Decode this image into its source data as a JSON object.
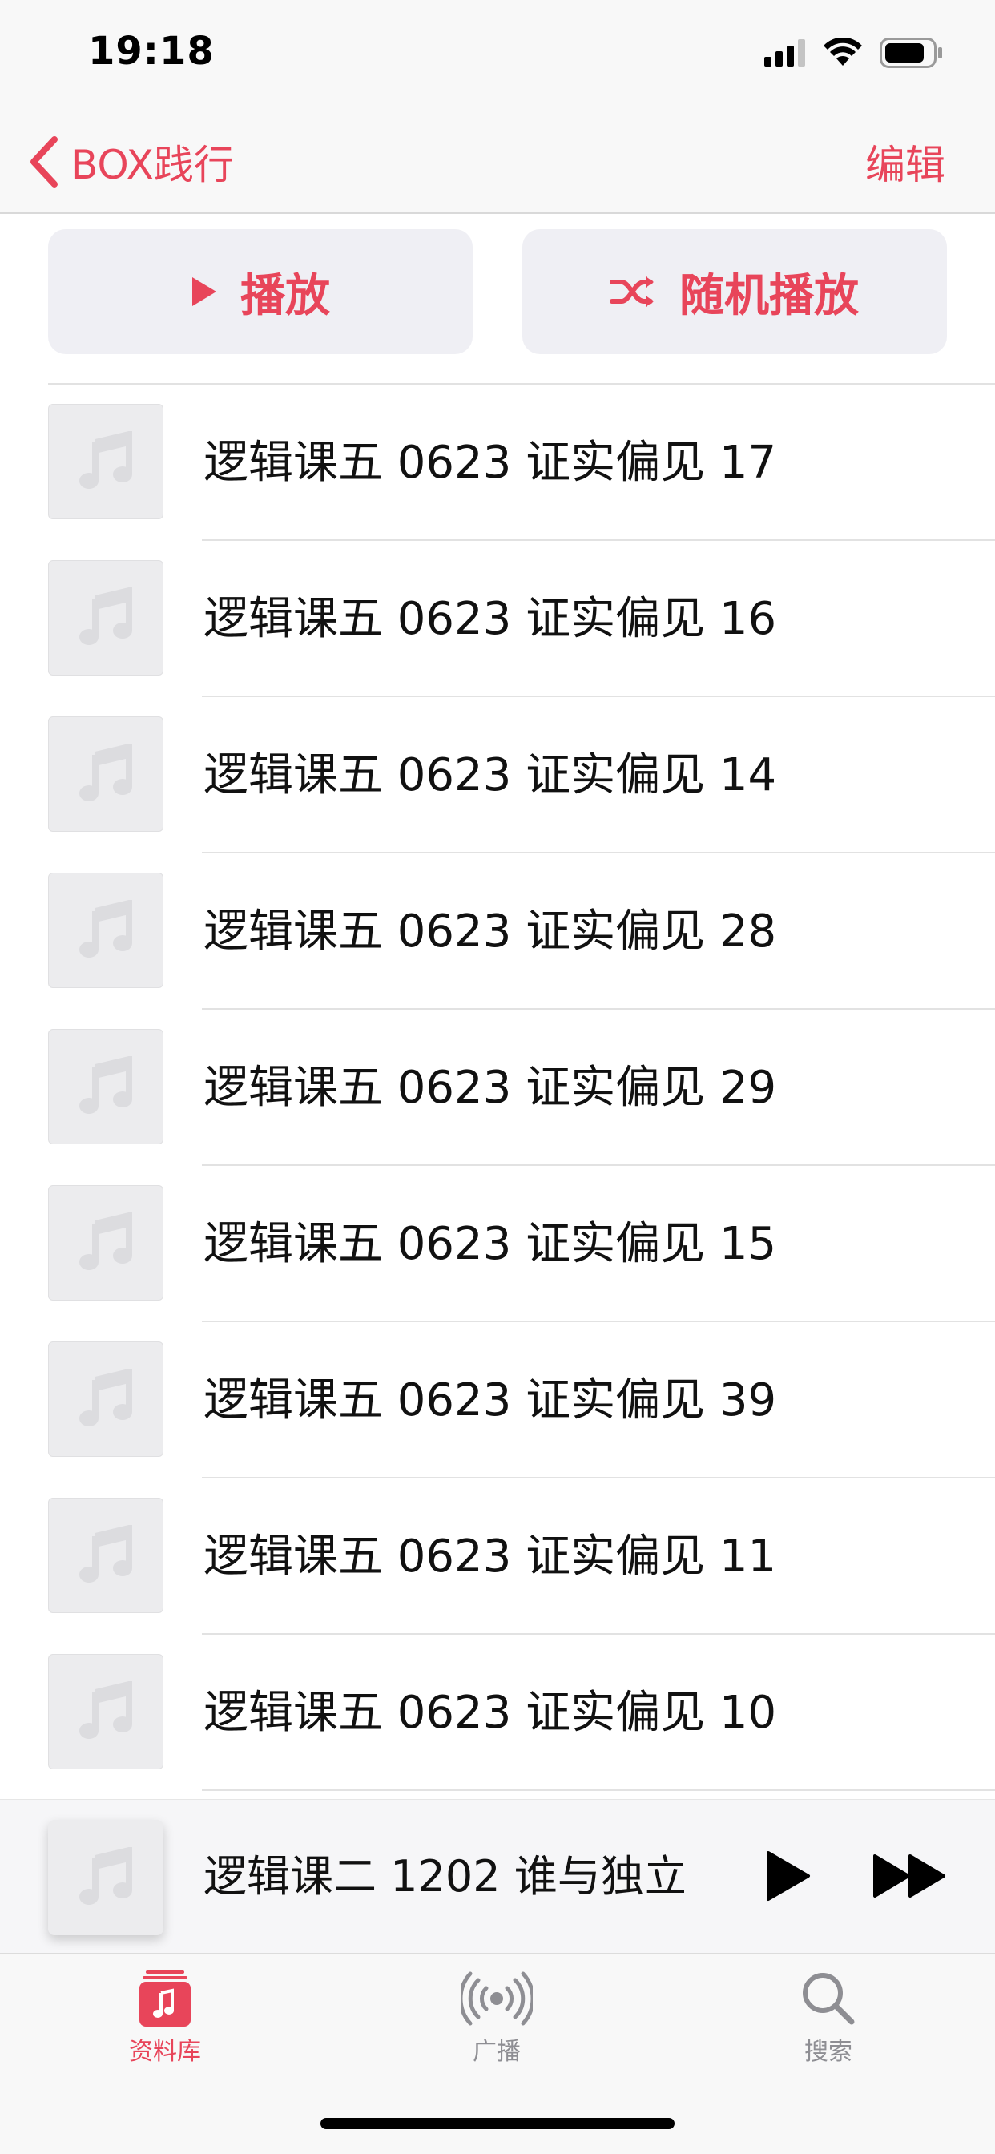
{
  "status_bar": {
    "time": "19:18"
  },
  "nav": {
    "back_label": "BOX践行",
    "edit_label": "编辑"
  },
  "actions": {
    "play_label": "播放",
    "shuffle_label": "随机播放"
  },
  "tracks": [
    {
      "title": "逻辑课五 0623 证实偏见 17"
    },
    {
      "title": "逻辑课五 0623 证实偏见 16"
    },
    {
      "title": "逻辑课五 0623 证实偏见 14"
    },
    {
      "title": "逻辑课五 0623 证实偏见 28"
    },
    {
      "title": "逻辑课五 0623 证实偏见 29"
    },
    {
      "title": "逻辑课五 0623 证实偏见 15"
    },
    {
      "title": "逻辑课五 0623 证实偏见 39"
    },
    {
      "title": "逻辑课五 0623 证实偏见 11"
    },
    {
      "title": "逻辑课五 0623 证实偏见 10"
    }
  ],
  "now_playing": {
    "title": "逻辑课二 1202 谁与独立..."
  },
  "tabs": [
    {
      "label": "资料库",
      "icon": "library-icon",
      "active": true
    },
    {
      "label": "广播",
      "icon": "radio-icon",
      "active": false
    },
    {
      "label": "搜索",
      "icon": "search-icon",
      "active": false
    }
  ],
  "colors": {
    "accent": "#e8455a",
    "inactive": "#8e8e93",
    "button_bg": "#efeff4"
  }
}
